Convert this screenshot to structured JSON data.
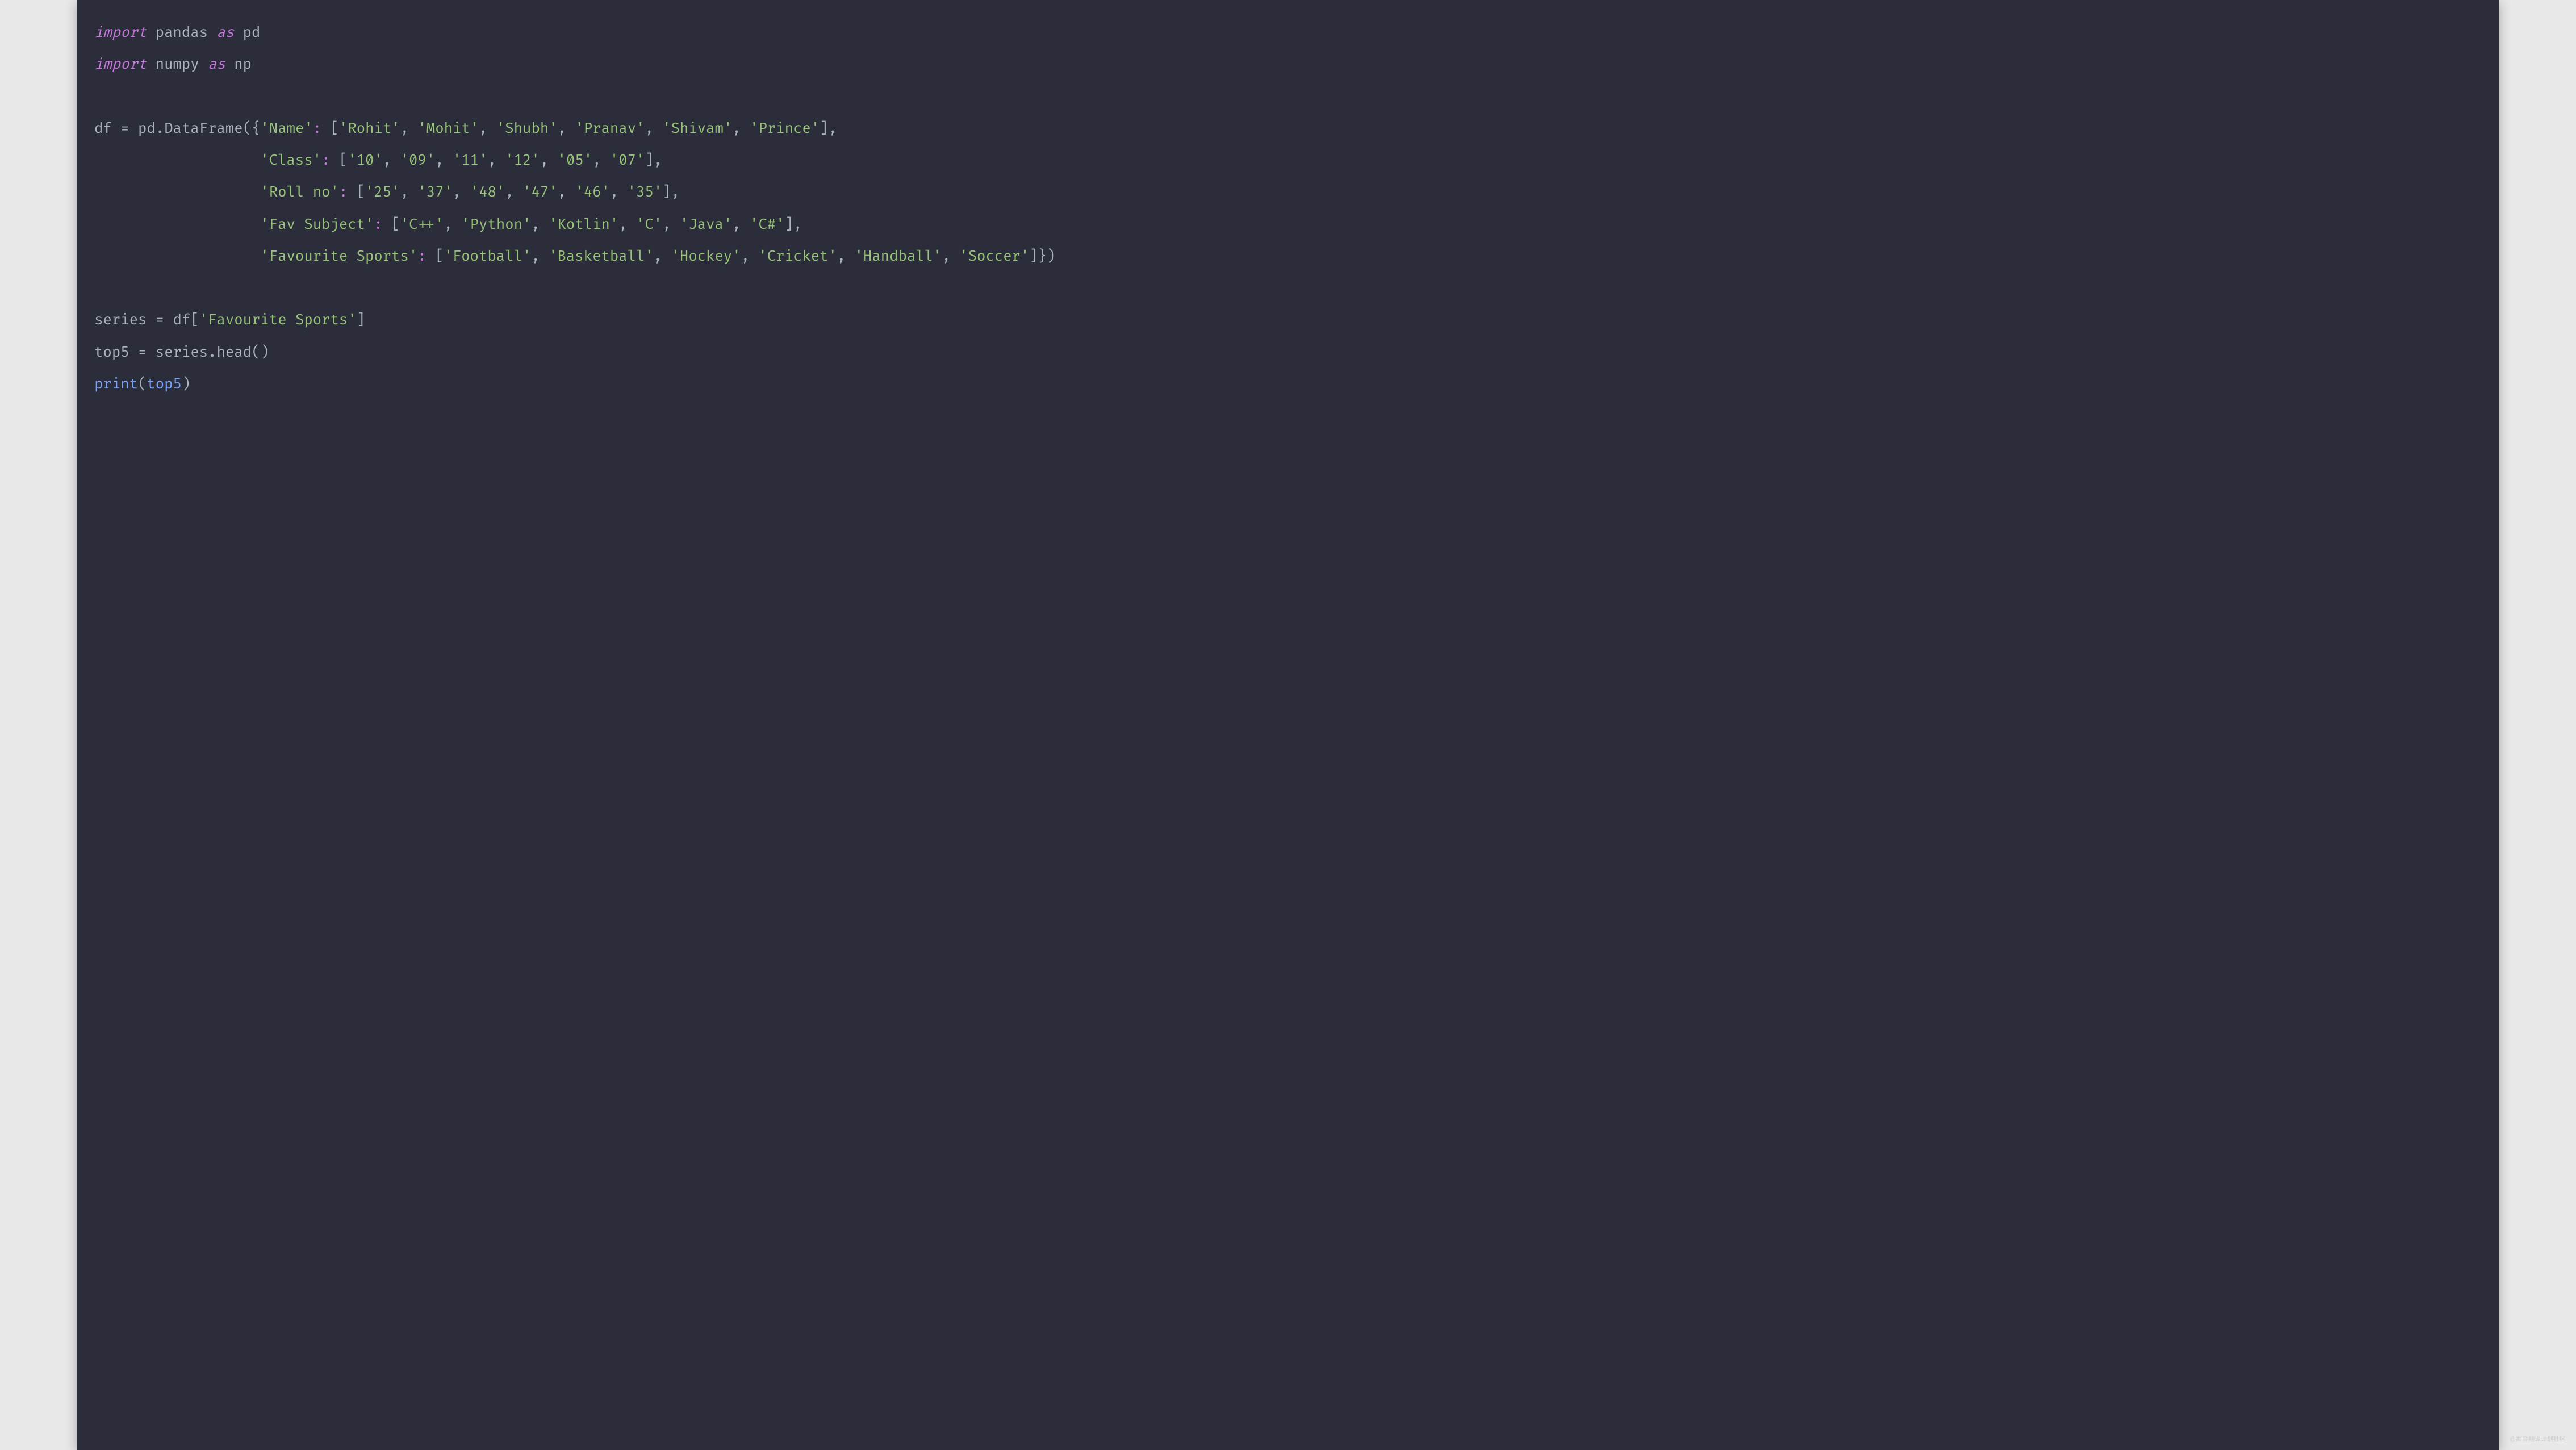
{
  "code": {
    "line1_import": "import",
    "line1_module": "pandas",
    "line1_as": "as",
    "line1_alias": "pd",
    "line2_import": "import",
    "line2_module": "numpy",
    "line2_as": "as",
    "line2_alias": "np",
    "df_var": "df",
    "eq": "=",
    "pd": "pd",
    "dot": ".",
    "dataframe": "DataFrame",
    "lparen": "(",
    "rparen": ")",
    "lbrace": "{",
    "rbrace": "}",
    "lbracket": "[",
    "rbracket": "]",
    "colon": ":",
    "comma": ",",
    "key_name": "'Name'",
    "name_vals": [
      "'Rohit'",
      "'Mohit'",
      "'Shubh'",
      "'Pranav'",
      "'Shivam'",
      "'Prince'"
    ],
    "key_class": "'Class'",
    "class_vals": [
      "'10'",
      "'09'",
      "'11'",
      "'12'",
      "'05'",
      "'07'"
    ],
    "key_roll": "'Roll no'",
    "roll_vals": [
      "'25'",
      "'37'",
      "'48'",
      "'47'",
      "'46'",
      "'35'"
    ],
    "key_fav": "'Fav Subject'",
    "fav_vals": [
      "'C++'",
      "'Python'",
      "'Kotlin'",
      "'C'",
      "'Java'",
      "'C#'"
    ],
    "key_sports": "'Favourite Sports'",
    "sports_vals": [
      "'Football'",
      "'Basketball'",
      "'Hockey'",
      "'Cricket'",
      "'Handball'",
      "'Soccer'"
    ],
    "series_var": "series",
    "df_ref": "df",
    "fav_sports_str": "'Favourite Sports'",
    "top5_var": "top5",
    "series_ref": "series",
    "head": "head",
    "print": "print",
    "top5_ref": "top5",
    "indent": "                   "
  },
  "watermark": "@掘金翻译计划社区"
}
